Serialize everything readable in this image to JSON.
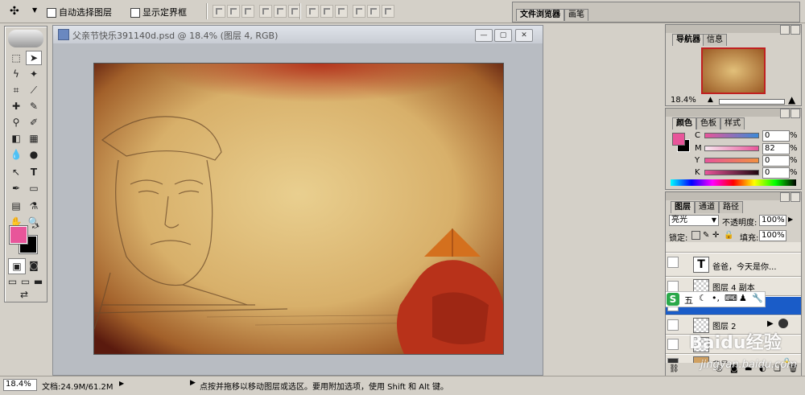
{
  "options_bar": {
    "auto_select_label": "自动选择图层",
    "show_bounds_label": "显示定界框",
    "right_tabs": [
      "文件浏览器",
      "画笔"
    ]
  },
  "document": {
    "title": "父亲节快乐391140d.psd @ 18.4% (图层 4, RGB)"
  },
  "navigator": {
    "tabs": [
      "导航器",
      "信息"
    ],
    "zoom": "18.4%"
  },
  "color_panel": {
    "tabs": [
      "颜色",
      "色板",
      "样式"
    ],
    "channels": [
      {
        "label": "C",
        "value": "0",
        "unit": "%"
      },
      {
        "label": "M",
        "value": "82",
        "unit": "%"
      },
      {
        "label": "Y",
        "value": "0",
        "unit": "%"
      },
      {
        "label": "K",
        "value": "0",
        "unit": "%"
      }
    ],
    "foreground_color": "#e8559a",
    "background_color": "#000000"
  },
  "layers_panel": {
    "tabs": [
      "图层",
      "通道",
      "路径"
    ],
    "blend_mode": "亮光",
    "opacity_label": "不透明度:",
    "opacity_value": "100%",
    "lock_label": "锁定:",
    "fill_label": "填充:",
    "fill_value": "100%",
    "layers": [
      {
        "name": "爸爸，今天是你...",
        "type": "text"
      },
      {
        "name": "图层 4 副本",
        "type": "pixel"
      },
      {
        "name": "图层 2",
        "type": "pixel"
      },
      {
        "name": "背景",
        "type": "background"
      }
    ]
  },
  "ime_bar": {
    "label": "五"
  },
  "status_bar": {
    "zoom": "18.4%",
    "doc_size": "文档:24.9M/61.2M",
    "hint": "点按并拖移以移动图层或选区。要用附加选项，使用 Shift 和 Alt 键。"
  },
  "watermark": {
    "text": "Baidu经验",
    "url": "jingyan.baidu.com"
  }
}
